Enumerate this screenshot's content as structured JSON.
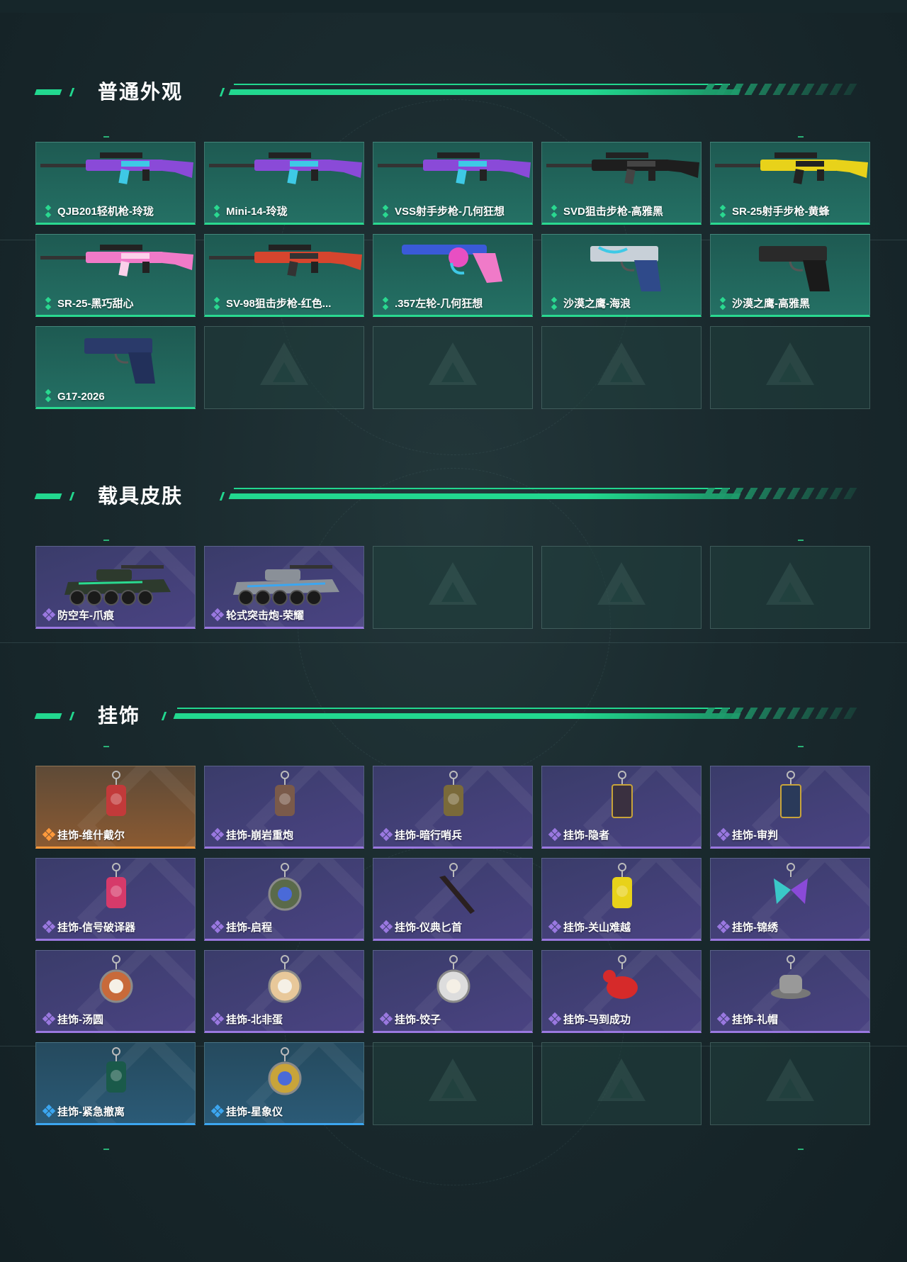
{
  "sections": [
    {
      "title": "普通外观",
      "items": [
        {
          "label": "QJB201轻机枪-玲珑",
          "rarity": "gun",
          "icon": "light-machine-gun"
        },
        {
          "label": "Mini-14-玲珑",
          "rarity": "gun",
          "icon": "rifle"
        },
        {
          "label": "VSS射手步枪-几何狂想",
          "rarity": "gun",
          "icon": "marksman-rifle"
        },
        {
          "label": "SVD狙击步枪-高雅黑",
          "rarity": "gun",
          "icon": "sniper-rifle"
        },
        {
          "label": "SR-25射手步枪-黄蜂",
          "rarity": "gun",
          "icon": "marksman-rifle"
        },
        {
          "label": "SR-25-黑巧甜心",
          "rarity": "gun",
          "icon": "marksman-rifle"
        },
        {
          "label": "SV-98狙击步枪-红色...",
          "rarity": "gun",
          "icon": "sniper-rifle"
        },
        {
          "label": ".357左轮-几何狂想",
          "rarity": "gun",
          "icon": "revolver"
        },
        {
          "label": "沙漠之鹰-海浪",
          "rarity": "gun",
          "icon": "pistol"
        },
        {
          "label": "沙漠之鹰-高雅黑",
          "rarity": "gun",
          "icon": "pistol"
        },
        {
          "label": "G17-2026",
          "rarity": "gun",
          "icon": "pistol"
        }
      ],
      "empty_slots": 4
    },
    {
      "title": "载具皮肤",
      "items": [
        {
          "label": "防空车-爪痕",
          "rarity": "purple",
          "icon": "armored-vehicle"
        },
        {
          "label": "轮式突击炮-荣耀",
          "rarity": "purple",
          "icon": "armored-vehicle"
        }
      ],
      "empty_slots": 3
    },
    {
      "title": "挂饰",
      "items": [
        {
          "label": "挂饰-维什戴尔",
          "rarity": "orange",
          "icon": "charm"
        },
        {
          "label": "挂饰-崩岩重炮",
          "rarity": "purple",
          "icon": "charm"
        },
        {
          "label": "挂饰-暗行哨兵",
          "rarity": "purple",
          "icon": "charm"
        },
        {
          "label": "挂饰-隐者",
          "rarity": "purple",
          "icon": "card-charm"
        },
        {
          "label": "挂饰-审判",
          "rarity": "purple",
          "icon": "card-charm"
        },
        {
          "label": "挂饰-信号破译器",
          "rarity": "purple",
          "icon": "charm"
        },
        {
          "label": "挂饰-启程",
          "rarity": "purple",
          "icon": "medallion-charm"
        },
        {
          "label": "挂饰-仪典匕首",
          "rarity": "purple",
          "icon": "dagger-charm"
        },
        {
          "label": "挂饰-关山难越",
          "rarity": "purple",
          "icon": "charm"
        },
        {
          "label": "挂饰-锦绣",
          "rarity": "purple",
          "icon": "butterfly-charm"
        },
        {
          "label": "挂饰-汤圆",
          "rarity": "purple",
          "icon": "bowl-charm"
        },
        {
          "label": "挂饰-北非蛋",
          "rarity": "purple",
          "icon": "bowl-charm"
        },
        {
          "label": "挂饰-饺子",
          "rarity": "purple",
          "icon": "bowl-charm"
        },
        {
          "label": "挂饰-马到成功",
          "rarity": "purple",
          "icon": "horse-charm"
        },
        {
          "label": "挂饰-礼帽",
          "rarity": "purple",
          "icon": "hat-charm"
        },
        {
          "label": "挂饰-紧急撤离",
          "rarity": "blue",
          "icon": "charm"
        },
        {
          "label": "挂饰-星象仪",
          "rarity": "blue",
          "icon": "medallion-charm"
        }
      ],
      "empty_slots": 3
    }
  ],
  "colors": {
    "accent": "#22d88f",
    "gun": "#2ad990",
    "purple": "#9a78e0",
    "orange": "#ff9a3c",
    "blue": "#3ca6f0"
  }
}
